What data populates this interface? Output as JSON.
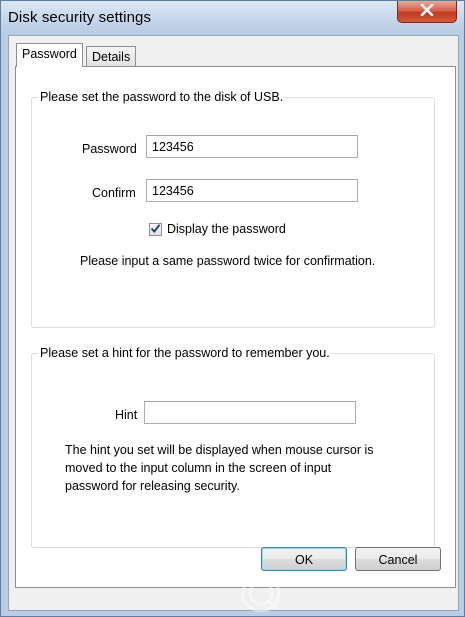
{
  "window": {
    "title": "Disk security settings"
  },
  "tabs": [
    {
      "label": "Password",
      "selected": true
    },
    {
      "label": "Details",
      "selected": false
    }
  ],
  "password_group": {
    "title": "Please set the password to the disk of USB.",
    "password_label": "Password",
    "password_value": "123456",
    "confirm_label": "Confirm",
    "confirm_value": "123456",
    "display_password_label": "Display the password",
    "display_password_checked": true,
    "instruction": "Please input a same password twice for confirmation."
  },
  "hint_group": {
    "title": "Please set a hint for the password to remember you.",
    "hint_label": "Hint",
    "hint_value": "",
    "description_lines": [
      "The hint you set will be displayed when mouse cursor is",
      "moved to the input column in the screen of input",
      "password for releasing security."
    ]
  },
  "buttons": {
    "ok_label": "OK",
    "cancel_label": "Cancel"
  },
  "colors": {
    "frame": "#b9cde4",
    "close_button": "#c2381e",
    "default_button_border": "#3c7fb1"
  },
  "icons": {
    "close": "close-icon",
    "check": "check-icon",
    "watermark": "watermark-logo-icon"
  }
}
